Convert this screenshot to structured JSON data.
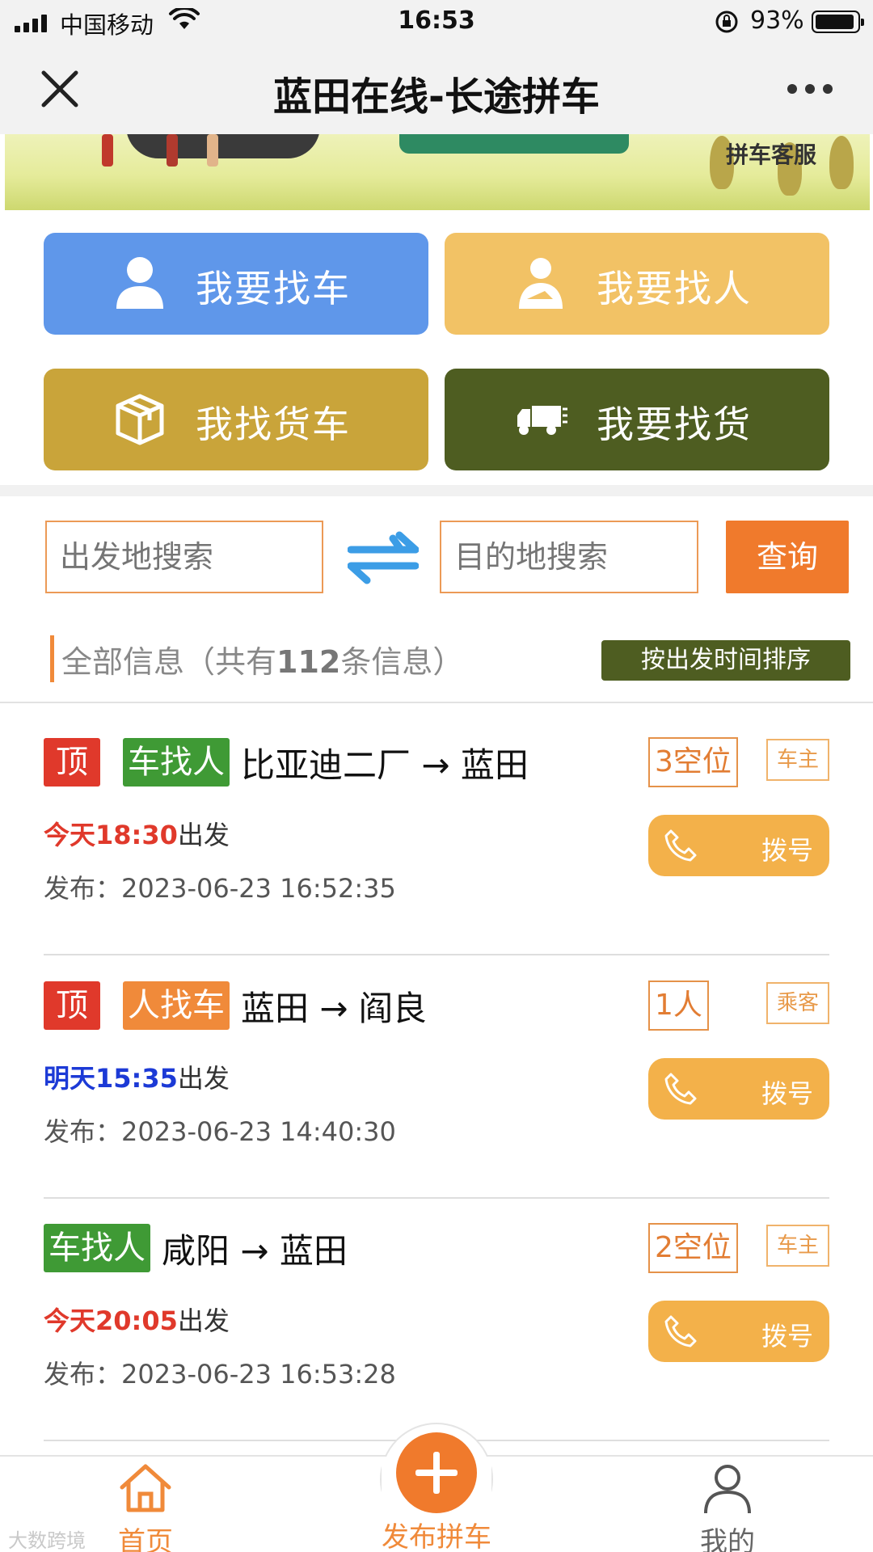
{
  "status_bar": {
    "carrier": "中国移动",
    "time": "16:53",
    "battery": "93%",
    "battery_level": 0.93
  },
  "nav": {
    "title": "蓝田在线-长途拼车",
    "close_icon": "close-icon",
    "more_icon": "more-icon"
  },
  "banner": {
    "service_label": "拼车客服"
  },
  "actions": [
    {
      "label": "我要找车",
      "icon": "person-icon",
      "color": "#5f97ea"
    },
    {
      "label": "我要找人",
      "icon": "driver-icon",
      "color": "#f2c265"
    },
    {
      "label": "我找货车",
      "icon": "box-icon",
      "color": "#c9a43a"
    },
    {
      "label": "我要找货",
      "icon": "truck-icon",
      "color": "#4e5d21"
    }
  ],
  "search": {
    "from_placeholder": "出发地搜索",
    "to_placeholder": "目的地搜索",
    "query_label": "查询"
  },
  "info": {
    "prefix": "全部信息（共有",
    "count": "112",
    "suffix": "条信息）",
    "sort_label": "按出发时间排序"
  },
  "listings": [
    {
      "top_tag": "顶",
      "type_tag": "车找人",
      "route": "比亚迪二厂 → 蓝田",
      "seats": "3空位",
      "role": "车主",
      "time": "今天18:30",
      "time_color": "#e0392b",
      "depart_suffix": "出发",
      "pub_label": "发布：",
      "published": "2023-06-23 16:52:35",
      "call_label": "拨号"
    },
    {
      "top_tag": "顶",
      "type_tag": "人找车",
      "route": "蓝田 → 阎良",
      "seats": "1人",
      "role": "乘客",
      "time": "明天15:35",
      "time_color": "#1c3ad6",
      "depart_suffix": "出发",
      "pub_label": "发布：",
      "published": "2023-06-23 14:40:30",
      "call_label": "拨号"
    },
    {
      "top_tag": "",
      "type_tag": "车找人",
      "route": "咸阳 → 蓝田",
      "seats": "2空位",
      "role": "车主",
      "time": "今天20:05",
      "time_color": "#e0392b",
      "depart_suffix": "出发",
      "pub_label": "发布：",
      "published": "2023-06-23 16:53:28",
      "call_label": "拨号"
    }
  ],
  "tabbar": {
    "home": "首页",
    "publish": "发布拼车",
    "mine": "我的"
  },
  "watermark": "大数跨境",
  "colors": {
    "accent": "#f07a2c",
    "green": "#3f9a35",
    "olive": "#4e5d21"
  }
}
